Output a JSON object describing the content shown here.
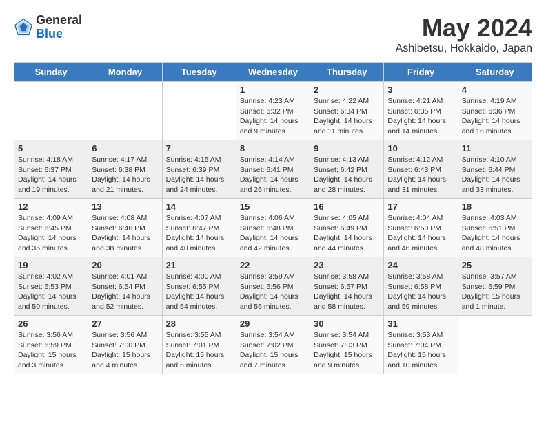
{
  "header": {
    "logo_general": "General",
    "logo_blue": "Blue",
    "month_title": "May 2024",
    "location": "Ashibetsu, Hokkaido, Japan"
  },
  "days_of_week": [
    "Sunday",
    "Monday",
    "Tuesday",
    "Wednesday",
    "Thursday",
    "Friday",
    "Saturday"
  ],
  "weeks": [
    [
      {
        "day": "",
        "info": ""
      },
      {
        "day": "",
        "info": ""
      },
      {
        "day": "",
        "info": ""
      },
      {
        "day": "1",
        "info": "Sunrise: 4:23 AM\nSunset: 6:32 PM\nDaylight: 14 hours\nand 9 minutes."
      },
      {
        "day": "2",
        "info": "Sunrise: 4:22 AM\nSunset: 6:34 PM\nDaylight: 14 hours\nand 11 minutes."
      },
      {
        "day": "3",
        "info": "Sunrise: 4:21 AM\nSunset: 6:35 PM\nDaylight: 14 hours\nand 14 minutes."
      },
      {
        "day": "4",
        "info": "Sunrise: 4:19 AM\nSunset: 6:36 PM\nDaylight: 14 hours\nand 16 minutes."
      }
    ],
    [
      {
        "day": "5",
        "info": "Sunrise: 4:18 AM\nSunset: 6:37 PM\nDaylight: 14 hours\nand 19 minutes."
      },
      {
        "day": "6",
        "info": "Sunrise: 4:17 AM\nSunset: 6:38 PM\nDaylight: 14 hours\nand 21 minutes."
      },
      {
        "day": "7",
        "info": "Sunrise: 4:15 AM\nSunset: 6:39 PM\nDaylight: 14 hours\nand 24 minutes."
      },
      {
        "day": "8",
        "info": "Sunrise: 4:14 AM\nSunset: 6:41 PM\nDaylight: 14 hours\nand 26 minutes."
      },
      {
        "day": "9",
        "info": "Sunrise: 4:13 AM\nSunset: 6:42 PM\nDaylight: 14 hours\nand 28 minutes."
      },
      {
        "day": "10",
        "info": "Sunrise: 4:12 AM\nSunset: 6:43 PM\nDaylight: 14 hours\nand 31 minutes."
      },
      {
        "day": "11",
        "info": "Sunrise: 4:10 AM\nSunset: 6:44 PM\nDaylight: 14 hours\nand 33 minutes."
      }
    ],
    [
      {
        "day": "12",
        "info": "Sunrise: 4:09 AM\nSunset: 6:45 PM\nDaylight: 14 hours\nand 35 minutes."
      },
      {
        "day": "13",
        "info": "Sunrise: 4:08 AM\nSunset: 6:46 PM\nDaylight: 14 hours\nand 38 minutes."
      },
      {
        "day": "14",
        "info": "Sunrise: 4:07 AM\nSunset: 6:47 PM\nDaylight: 14 hours\nand 40 minutes."
      },
      {
        "day": "15",
        "info": "Sunrise: 4:06 AM\nSunset: 6:48 PM\nDaylight: 14 hours\nand 42 minutes."
      },
      {
        "day": "16",
        "info": "Sunrise: 4:05 AM\nSunset: 6:49 PM\nDaylight: 14 hours\nand 44 minutes."
      },
      {
        "day": "17",
        "info": "Sunrise: 4:04 AM\nSunset: 6:50 PM\nDaylight: 14 hours\nand 46 minutes."
      },
      {
        "day": "18",
        "info": "Sunrise: 4:03 AM\nSunset: 6:51 PM\nDaylight: 14 hours\nand 48 minutes."
      }
    ],
    [
      {
        "day": "19",
        "info": "Sunrise: 4:02 AM\nSunset: 6:53 PM\nDaylight: 14 hours\nand 50 minutes."
      },
      {
        "day": "20",
        "info": "Sunrise: 4:01 AM\nSunset: 6:54 PM\nDaylight: 14 hours\nand 52 minutes."
      },
      {
        "day": "21",
        "info": "Sunrise: 4:00 AM\nSunset: 6:55 PM\nDaylight: 14 hours\nand 54 minutes."
      },
      {
        "day": "22",
        "info": "Sunrise: 3:59 AM\nSunset: 6:56 PM\nDaylight: 14 hours\nand 56 minutes."
      },
      {
        "day": "23",
        "info": "Sunrise: 3:58 AM\nSunset: 6:57 PM\nDaylight: 14 hours\nand 58 minutes."
      },
      {
        "day": "24",
        "info": "Sunrise: 3:58 AM\nSunset: 6:58 PM\nDaylight: 14 hours\nand 59 minutes."
      },
      {
        "day": "25",
        "info": "Sunrise: 3:57 AM\nSunset: 6:59 PM\nDaylight: 15 hours\nand 1 minute."
      }
    ],
    [
      {
        "day": "26",
        "info": "Sunrise: 3:56 AM\nSunset: 6:59 PM\nDaylight: 15 hours\nand 3 minutes."
      },
      {
        "day": "27",
        "info": "Sunrise: 3:56 AM\nSunset: 7:00 PM\nDaylight: 15 hours\nand 4 minutes."
      },
      {
        "day": "28",
        "info": "Sunrise: 3:55 AM\nSunset: 7:01 PM\nDaylight: 15 hours\nand 6 minutes."
      },
      {
        "day": "29",
        "info": "Sunrise: 3:54 AM\nSunset: 7:02 PM\nDaylight: 15 hours\nand 7 minutes."
      },
      {
        "day": "30",
        "info": "Sunrise: 3:54 AM\nSunset: 7:03 PM\nDaylight: 15 hours\nand 9 minutes."
      },
      {
        "day": "31",
        "info": "Sunrise: 3:53 AM\nSunset: 7:04 PM\nDaylight: 15 hours\nand 10 minutes."
      },
      {
        "day": "",
        "info": ""
      }
    ]
  ]
}
